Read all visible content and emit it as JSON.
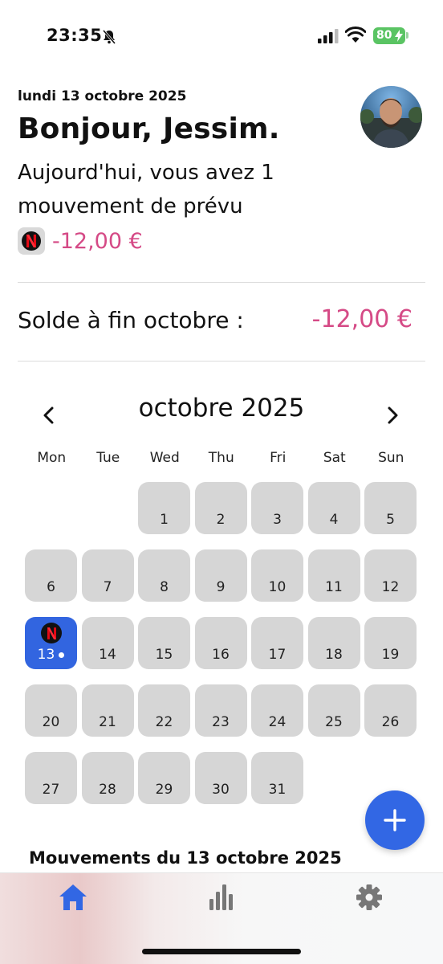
{
  "status_bar": {
    "time": "23:35",
    "battery": "80"
  },
  "header": {
    "date": "lundi 13 octobre 2025",
    "greeting": "Bonjour, Jessim.",
    "summary": "Aujourd'hui, vous avez 1 mouvement de prévu",
    "upcoming": {
      "icon": "netflix-icon",
      "amount": "-12,00 €"
    }
  },
  "balance": {
    "label": "Solde à fin octobre :",
    "value": "-12,00 €"
  },
  "calendar": {
    "title": "octobre 2025",
    "weekdays": [
      "Mon",
      "Tue",
      "Wed",
      "Thu",
      "Fri",
      "Sat",
      "Sun"
    ],
    "leading_empty": 2,
    "days": [
      "1",
      "2",
      "3",
      "4",
      "5",
      "6",
      "7",
      "8",
      "9",
      "10",
      "11",
      "12",
      "13",
      "14",
      "15",
      "16",
      "17",
      "18",
      "19",
      "20",
      "21",
      "22",
      "23",
      "24",
      "25",
      "26",
      "27",
      "28",
      "29",
      "30",
      "31"
    ],
    "today": "13",
    "today_icon": "netflix-icon"
  },
  "movements": {
    "title": "Mouvements du 13 octobre 2025"
  },
  "tabs": [
    {
      "icon": "home-icon",
      "active": true
    },
    {
      "icon": "chart-icon",
      "active": false
    },
    {
      "icon": "gear-icon",
      "active": false
    }
  ],
  "colors": {
    "accent": "#3265e0",
    "negative": "#d54a86",
    "day_bg": "#d6d6d6",
    "netflix": "#e50914"
  }
}
